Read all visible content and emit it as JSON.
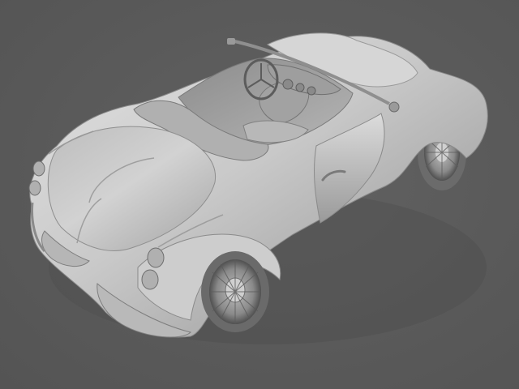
{
  "scene": {
    "background_color": "#5a5a5a",
    "model_color": "#c8c8c8",
    "subject": "car-render"
  }
}
